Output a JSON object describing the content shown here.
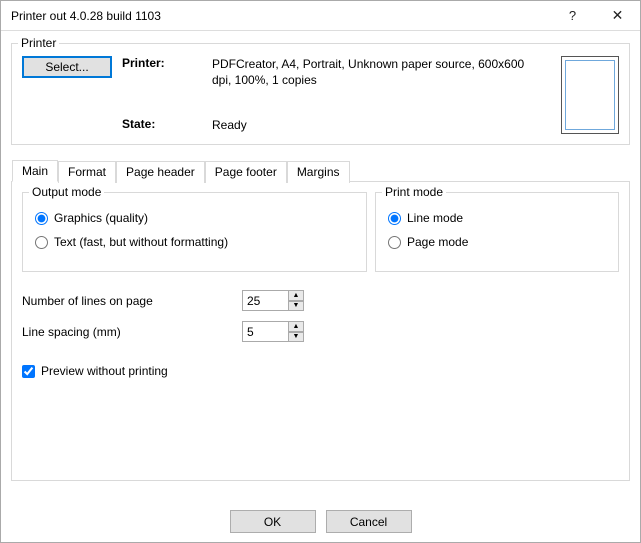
{
  "window": {
    "title": "Printer out 4.0.28 build 1103",
    "help": "?",
    "close": "✕"
  },
  "printer_group": {
    "label": "Printer",
    "select_btn": "Select...",
    "printer_label": "Printer:",
    "printer_value": "PDFCreator, A4, Portrait, Unknown paper source, 600x600 dpi, 100%, 1 copies",
    "state_label": "State:",
    "state_value": "Ready"
  },
  "tabs": [
    "Main",
    "Format",
    "Page header",
    "Page footer",
    "Margins"
  ],
  "active_tab": 0,
  "main_tab": {
    "output_mode": {
      "label": "Output mode",
      "options": [
        {
          "label": "Graphics (quality)",
          "checked": true
        },
        {
          "label": "Text (fast, but without formatting)",
          "checked": false
        }
      ]
    },
    "print_mode": {
      "label": "Print mode",
      "options": [
        {
          "label": "Line mode",
          "checked": true
        },
        {
          "label": "Page mode",
          "checked": false
        }
      ]
    },
    "lines_label": "Number of lines on page",
    "lines_value": "25",
    "spacing_label": "Line spacing (mm)",
    "spacing_value": "5",
    "preview_label": "Preview without printing",
    "preview_checked": true
  },
  "buttons": {
    "ok": "OK",
    "cancel": "Cancel"
  }
}
